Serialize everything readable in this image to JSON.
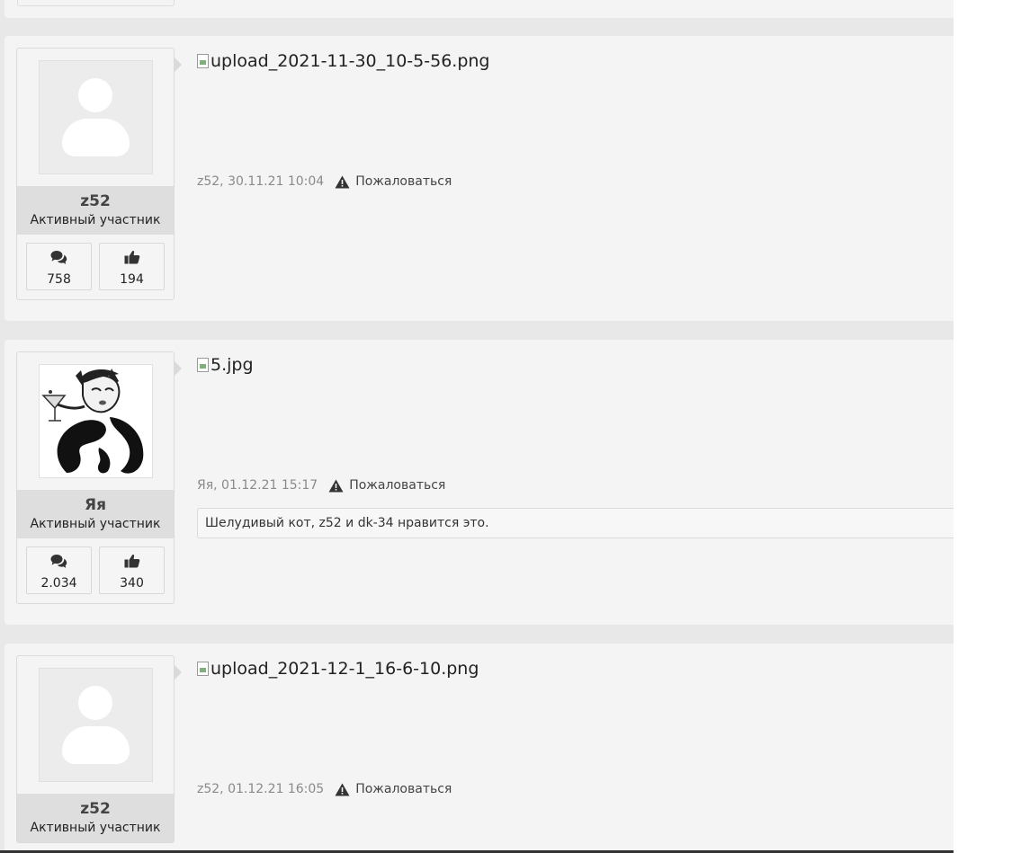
{
  "posts": [
    {
      "author": "z52",
      "role": "Активный участник",
      "messages": "758",
      "likes": "194",
      "attachment": "upload_2021-11-30_10-5-56.png",
      "date": "z52, 30.11.21 10:04",
      "report_label": "Пожаловаться"
    },
    {
      "author": "Яя",
      "role": "Активный участник",
      "messages": "2.034",
      "likes": "340",
      "attachment": "5.jpg",
      "date": "Яя, 01.12.21 15:17",
      "report_label": "Пожаловаться",
      "likes_text": "Шелудивый кот, z52 и dk-34 нравится это."
    },
    {
      "author": "z52",
      "role": "Активный участник",
      "attachment": "upload_2021-12-1_16-6-10.png",
      "date": "z52, 01.12.21 16:05",
      "report_label": "Пожаловаться"
    }
  ],
  "icons": {
    "messages": "comments-icon",
    "likes": "thumbs-up-icon",
    "report": "warning-icon",
    "avatar_default": "default-avatar-icon"
  },
  "colors": {
    "page_background": "#e8e8e8",
    "post_background": "#f4f4f4",
    "namebox_background": "#dedede",
    "meta_text": "#8a8a8a"
  }
}
